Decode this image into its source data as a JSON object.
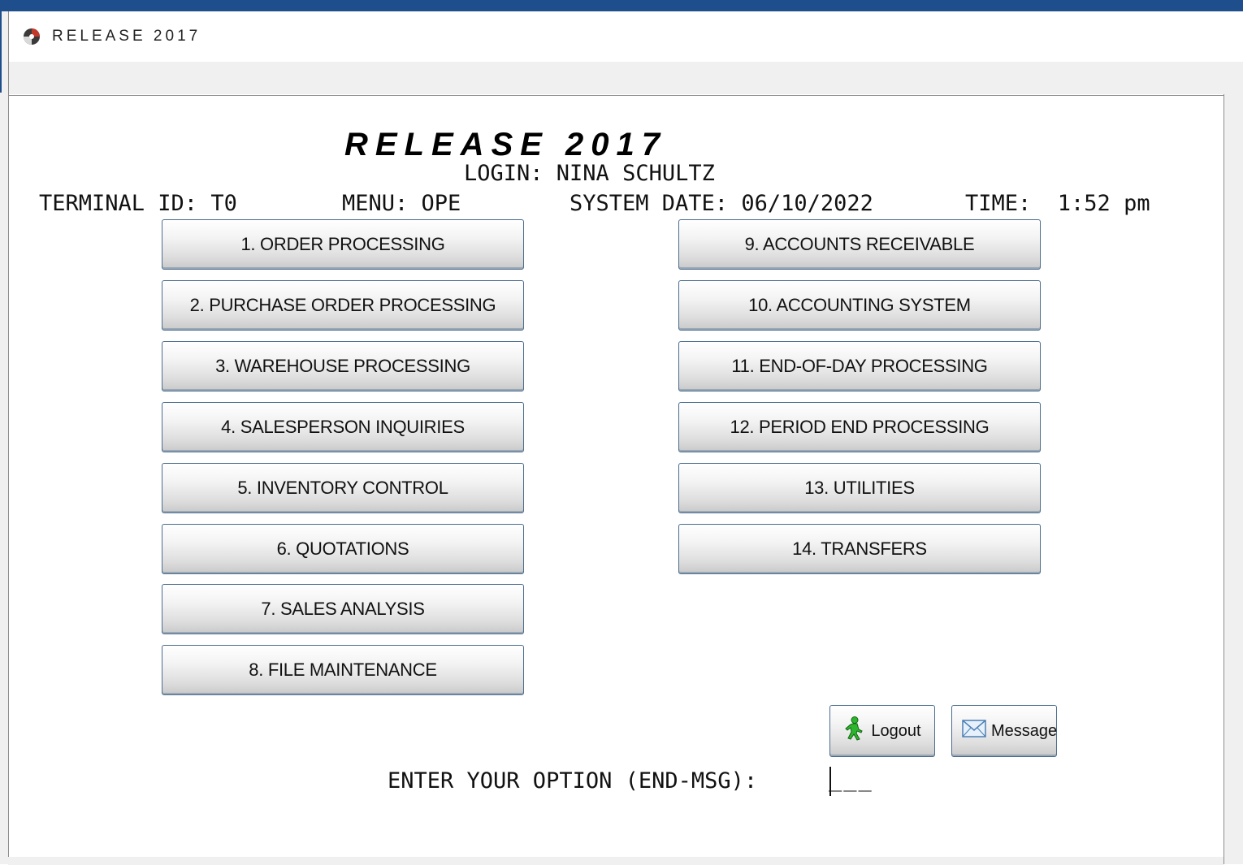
{
  "window": {
    "title": "RELEASE 2017"
  },
  "banner": {
    "title": "RELEASE 2017",
    "login": "LOGIN: NINA SCHULTZ"
  },
  "status": {
    "terminal": "TERMINAL ID: T0",
    "menu": "MENU: OPE",
    "system_date": "SYSTEM DATE: 06/10/2022",
    "time": "TIME:  1:52 pm"
  },
  "menu": {
    "left": [
      "1. ORDER PROCESSING",
      "2. PURCHASE ORDER PROCESSING",
      "3. WAREHOUSE PROCESSING",
      "4. SALESPERSON INQUIRIES",
      "5. INVENTORY CONTROL",
      "6. QUOTATIONS",
      "7. SALES ANALYSIS",
      "8. FILE MAINTENANCE"
    ],
    "right": [
      "9. ACCOUNTS RECEIVABLE",
      "10. ACCOUNTING SYSTEM",
      "11. END-OF-DAY PROCESSING",
      "12. PERIOD END PROCESSING",
      "13. UTILITIES",
      "14. TRANSFERS"
    ]
  },
  "actions": {
    "logout_label": "Logout",
    "message_label": "Message"
  },
  "prompt": {
    "label": "ENTER YOUR OPTION (END-MSG):",
    "value": "",
    "blanks": "___"
  },
  "icons": {
    "app": "app-logo-icon",
    "logout": "person-walking-icon",
    "message": "envelope-icon"
  },
  "colors": {
    "accent": "#1f4e8c",
    "button_border": "#4a6d8f"
  }
}
